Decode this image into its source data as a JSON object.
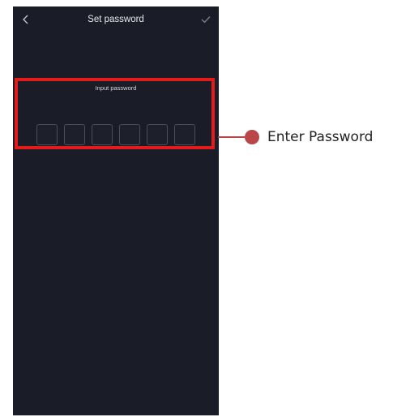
{
  "screen": {
    "title": "Set password",
    "back_icon": "chevron-left-icon",
    "confirm_icon": "checkmark-icon",
    "password_label": "Input password",
    "password_digits": [
      "",
      "",
      "",
      "",
      "",
      ""
    ]
  },
  "annotation": {
    "label": "Enter Password",
    "highlight_color": "#e31b1b",
    "marker_color": "#b9474a"
  },
  "colors": {
    "background": "#1a1c27",
    "box_border": "#4a4d5c"
  }
}
